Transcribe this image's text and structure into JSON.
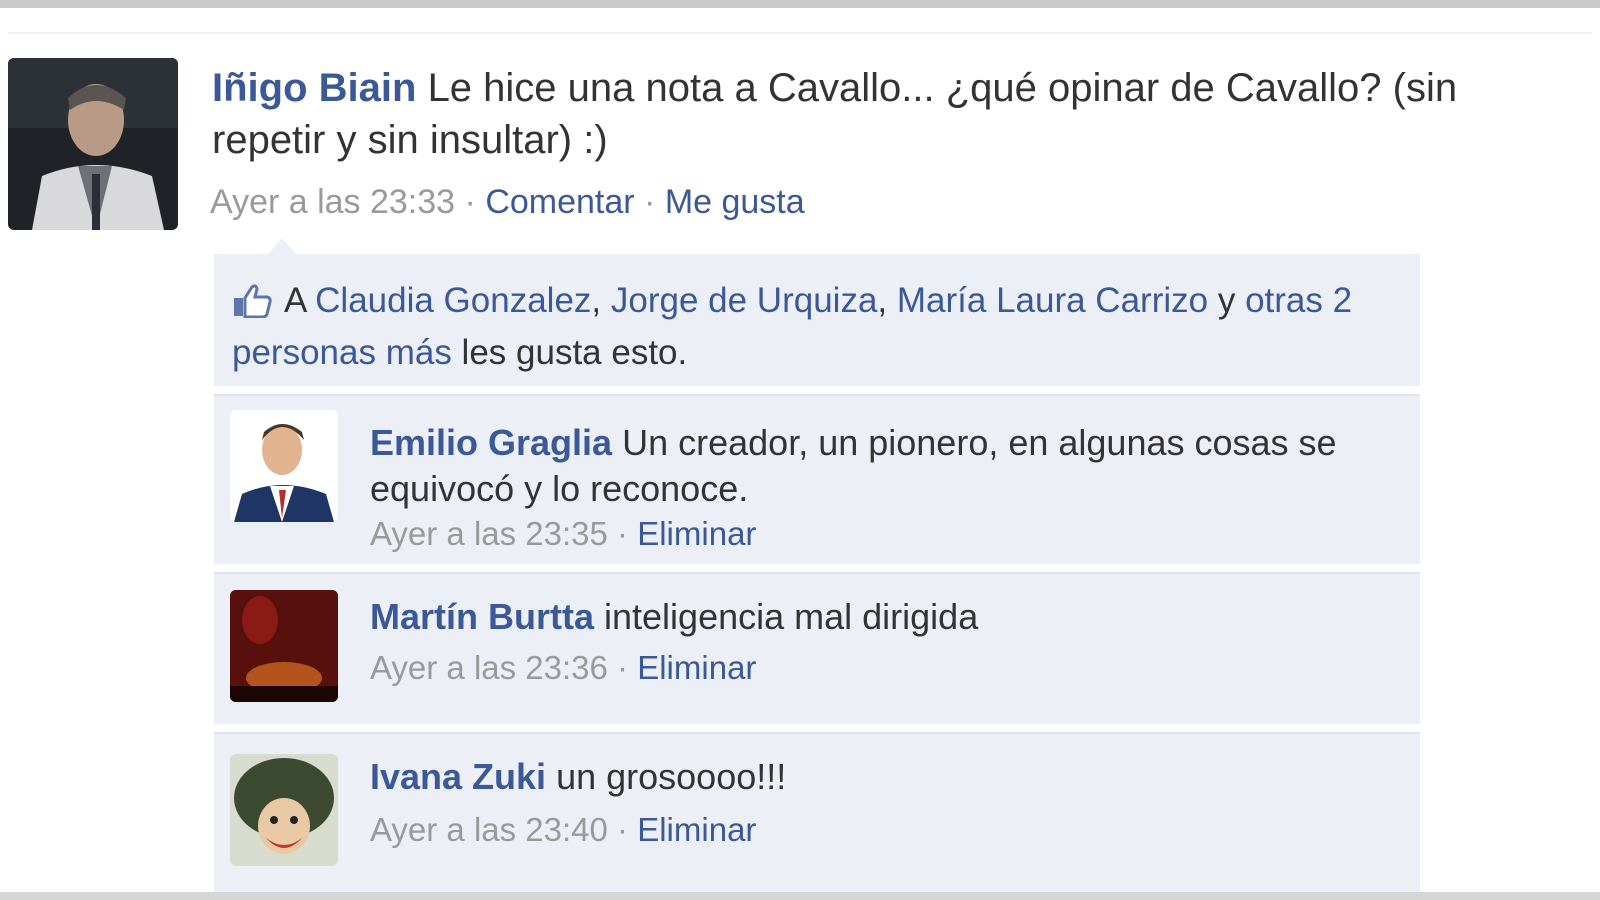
{
  "post": {
    "author": "Iñigo Biain",
    "text": "Le hice una nota a Cavallo... ¿qué opinar de Cavallo? (sin repetir y sin insultar) :)",
    "timestamp": "Ayer a las 23:33",
    "sep1": " · ",
    "comment_label": "Comentar",
    "sep2": " · ",
    "like_label": "Me gusta"
  },
  "likes": {
    "prefix": "A ",
    "person1": "Claudia Gonzalez",
    "comma1": ", ",
    "person2": "Jorge de Urquiza",
    "comma2": ", ",
    "person3": "María Laura Carrizo",
    "connector": " y ",
    "others": "otras 2 personas más",
    "suffix": " les gusta esto."
  },
  "comments": [
    {
      "author": "Emilio Graglia",
      "text": "Un creador, un pionero, en algunas cosas se equivocó y lo reconoce.",
      "timestamp": "Ayer a las 23:35",
      "sep": " · ",
      "action": "Eliminar"
    },
    {
      "author": "Martín Burtta",
      "text": "inteligencia mal dirigida",
      "timestamp": "Ayer a las 23:36",
      "sep": " · ",
      "action": "Eliminar"
    },
    {
      "author": "Ivana Zuki",
      "text": "un grosoooo!!!",
      "timestamp": "Ayer a las 23:40",
      "sep": " · ",
      "action": "Eliminar"
    }
  ],
  "colors": {
    "link": "#3b5998",
    "meta": "#9a9a9a",
    "panel": "#eceff5"
  }
}
